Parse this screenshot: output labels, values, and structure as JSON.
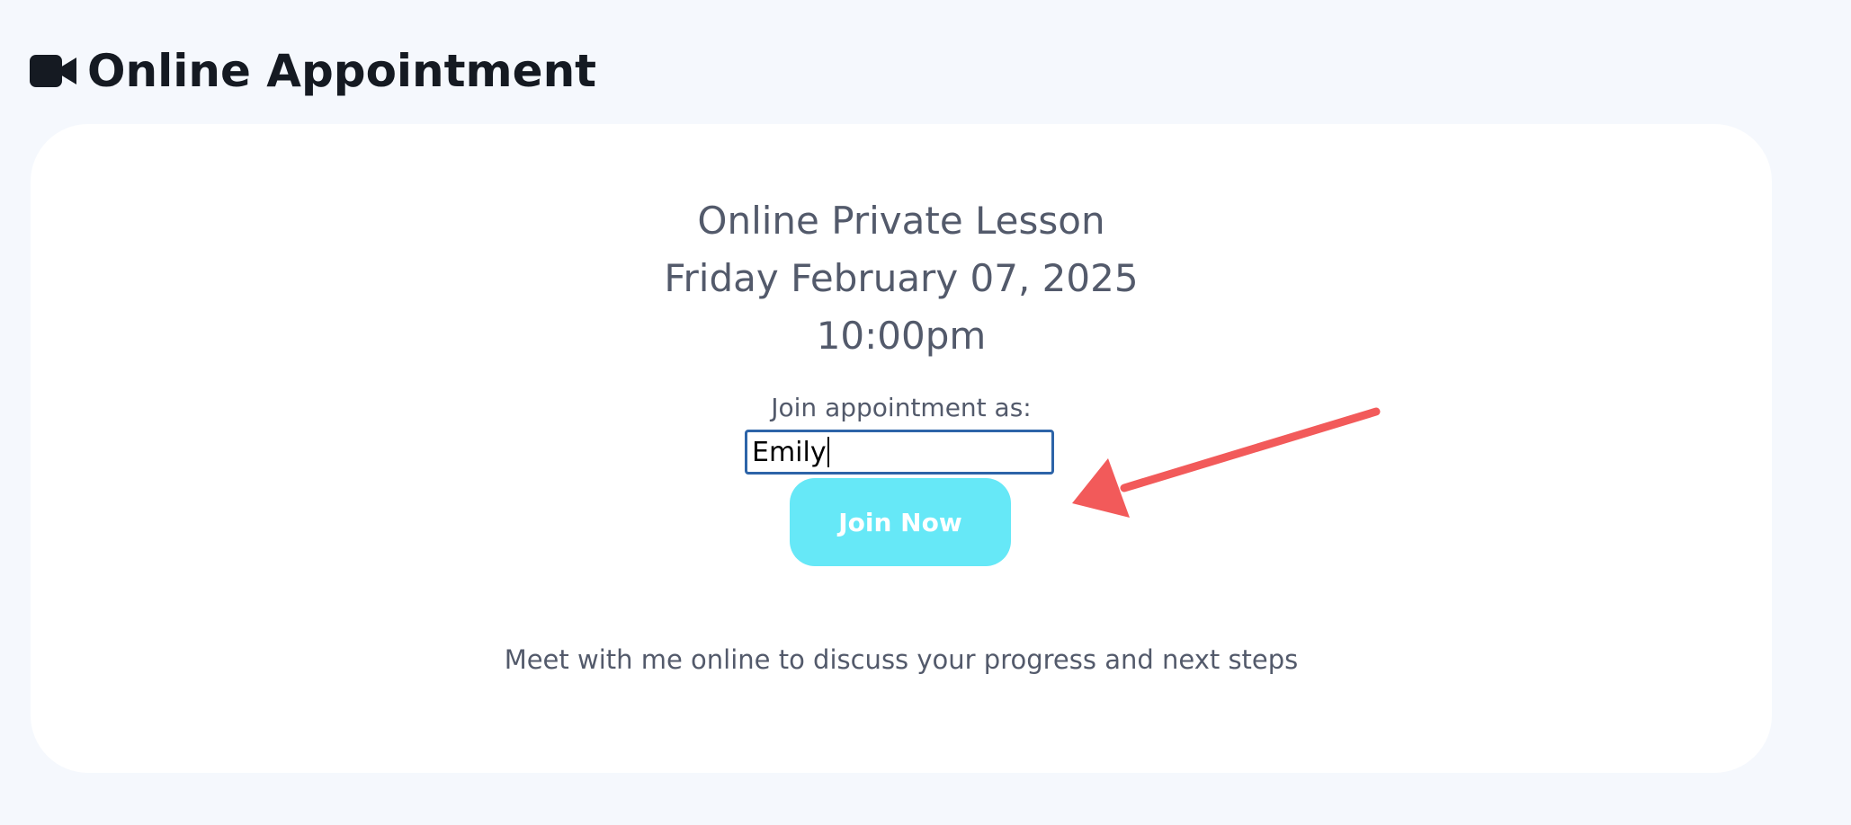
{
  "header": {
    "icon": "video-camera-icon",
    "title": "Online Appointment"
  },
  "appointment": {
    "name": "Online Private Lesson",
    "date": "Friday February 07, 2025",
    "time": "10:00pm",
    "join_label": "Join appointment as:",
    "name_value": "Emily",
    "join_button": "Join Now",
    "description": "Meet with me online to discuss your progress and next steps"
  },
  "colors": {
    "page_background": "#f5f8fd",
    "card_background": "#ffffff",
    "button_background": "#66e8f7",
    "input_border": "#2d64a8",
    "annotation_arrow": "#f25a5a",
    "title_text": "#151a22",
    "body_text": "#535a6b"
  }
}
